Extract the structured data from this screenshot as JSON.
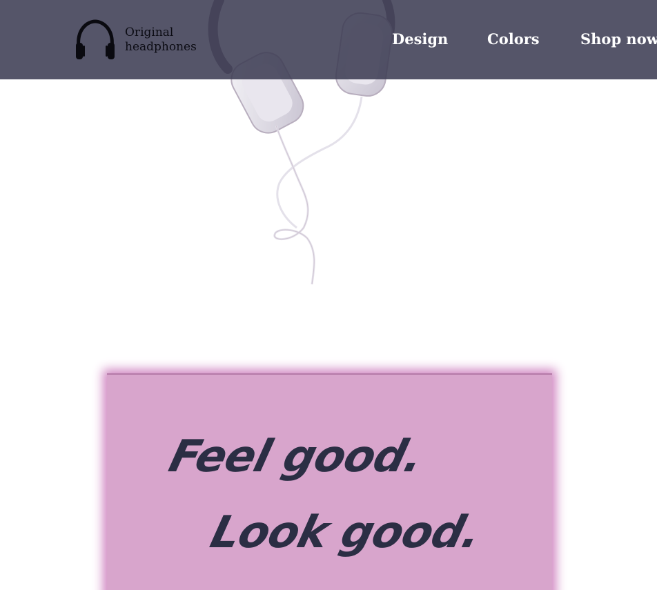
{
  "brand": {
    "line1": "Original",
    "line2": "headphones",
    "icon": "headphones-icon"
  },
  "nav": {
    "items": [
      {
        "label": "Design"
      },
      {
        "label": "Colors"
      },
      {
        "label": "Shop now"
      }
    ]
  },
  "hero": {
    "image": "headphones-image"
  },
  "promo": {
    "line1": "Feel good.",
    "line2": "Look good."
  },
  "colors": {
    "navbar": "#3e3e54",
    "card": "#d8a5cc",
    "card_glow": "#d189c3",
    "slogan": "#2b2e44",
    "nav_text": "#ffffff"
  }
}
